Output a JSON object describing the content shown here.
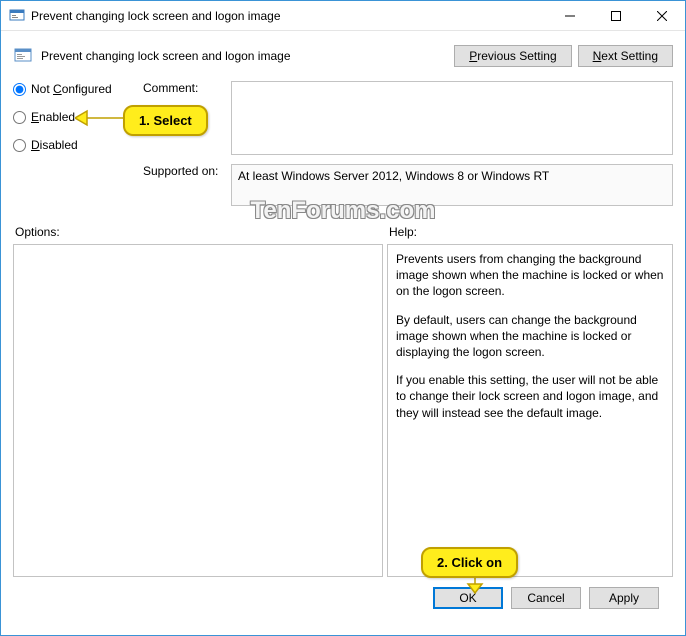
{
  "titlebar": {
    "title": "Prevent changing lock screen and logon image"
  },
  "header": {
    "title": "Prevent changing lock screen and logon image",
    "prev": "Previous Setting",
    "next": "Next Setting",
    "prev_u": "P",
    "next_u": "N"
  },
  "radios": {
    "not_configured": "Not Configured",
    "not_configured_u": "C",
    "enabled": "Enabled",
    "enabled_u": "E",
    "disabled": "Disabled",
    "disabled_u": "D"
  },
  "labels": {
    "comment": "Comment:",
    "supported": "Supported on:",
    "options": "Options:",
    "help": "Help:"
  },
  "supported_text": "At least Windows Server 2012, Windows 8 or Windows RT",
  "help_text": {
    "p1": "Prevents users from changing the background image shown when the machine is locked or when on the logon screen.",
    "p2": "By default, users can change the background image shown when the machine is locked or displaying the logon screen.",
    "p3": "If you enable this setting, the user will not be able to change their lock screen and logon image, and they will instead see the default image."
  },
  "footer": {
    "ok": "OK",
    "cancel": "Cancel",
    "apply": "Apply"
  },
  "callouts": {
    "select": "1. Select",
    "click": "2. Click on"
  },
  "watermark": "TenForums.com"
}
